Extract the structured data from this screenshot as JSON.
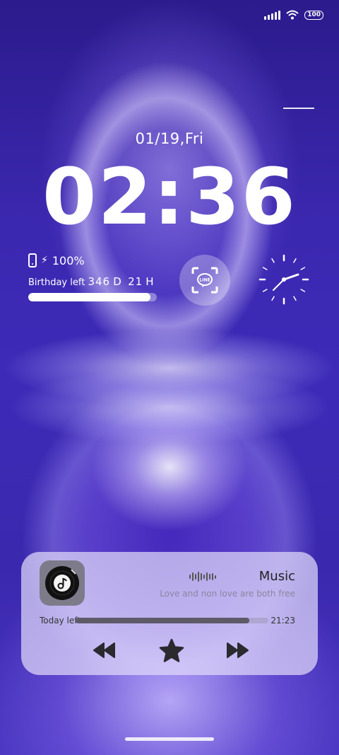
{
  "status_bar": {
    "signal_icon": "signal-bars-icon",
    "wifi_icon": "wifi-icon",
    "battery_label": "100"
  },
  "lockscreen": {
    "date": "01/19,Fri",
    "time": "02:36"
  },
  "battery_widget": {
    "percent_label": "100%",
    "birthday_prefix": "Birthday left",
    "birthday_days": "346",
    "birthday_days_unit": "D",
    "birthday_hours": "21",
    "birthday_hours_unit": "H",
    "birthday_progress": 0.95
  },
  "shortcut": {
    "line_label": "LINE"
  },
  "music_card": {
    "title": "Music",
    "subtitle": "Love and non love are both free",
    "today_label": "Today left",
    "time_label": "21:23",
    "progress": 0.9,
    "controls": [
      "previous-icon",
      "star-icon",
      "next-icon"
    ]
  }
}
